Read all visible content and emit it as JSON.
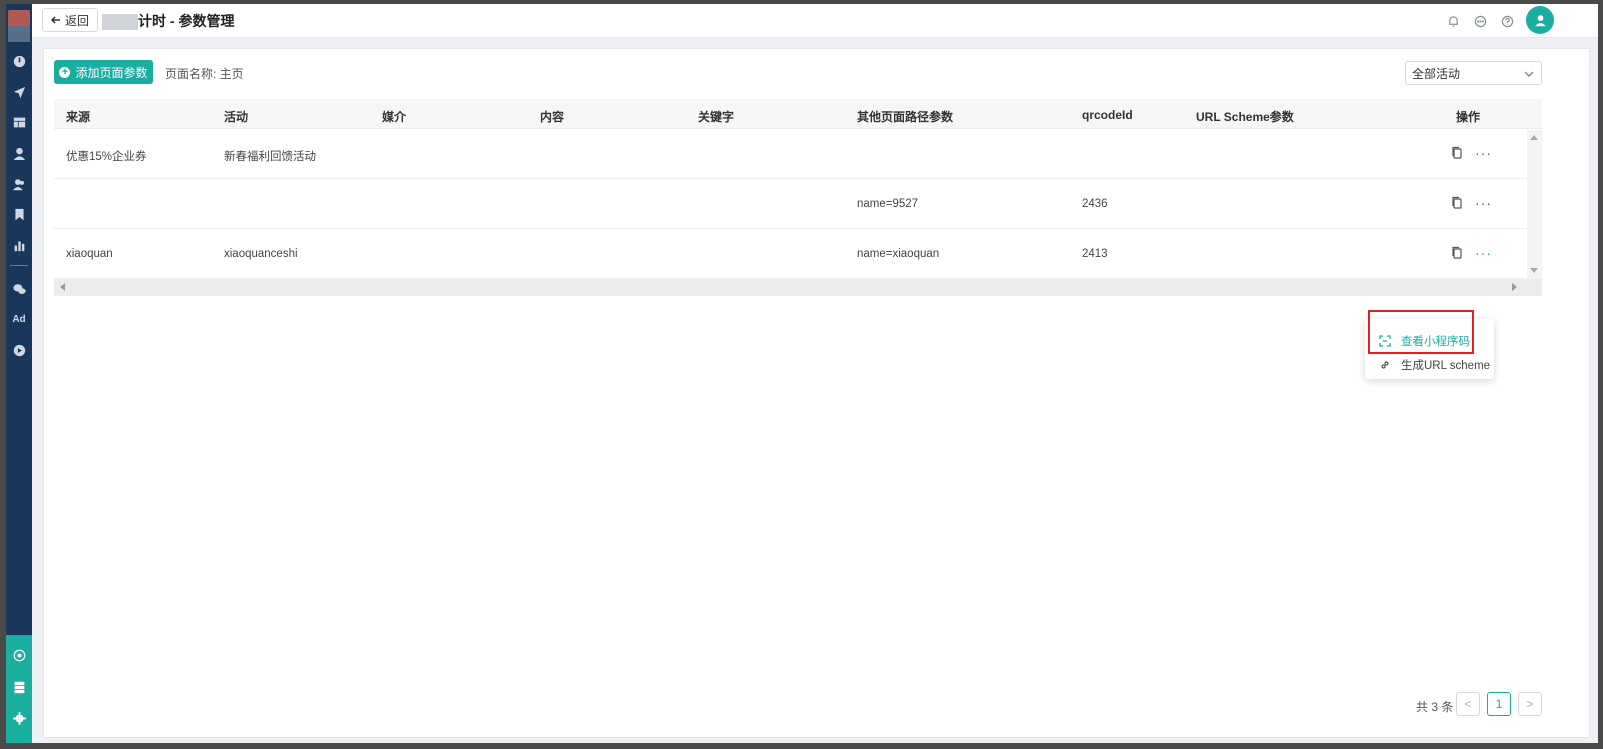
{
  "header": {
    "back_label": "返回",
    "title": "计时 - 参数管理"
  },
  "toolbar": {
    "add_label": "添加页面参数",
    "page_name": "页面名称: 主页",
    "activity_select": "全部活动"
  },
  "table": {
    "columns": [
      "来源",
      "活动",
      "媒介",
      "内容",
      "关键字",
      "其他页面路径参数",
      "qrcodeId",
      "URL Scheme参数",
      "操作"
    ],
    "rows": [
      {
        "source": "优惠15%企业券",
        "activity": "新春福利回馈活动",
        "medium": "",
        "content": "",
        "keyword": "",
        "other_params": "",
        "qrcode_id": "",
        "url_scheme": ""
      },
      {
        "source": "",
        "activity": "",
        "medium": "",
        "content": "",
        "keyword": "",
        "other_params": "name=9527",
        "qrcode_id": "2436",
        "url_scheme": ""
      },
      {
        "source": "xiaoquan",
        "activity": "xiaoquanceshi",
        "medium": "",
        "content": "",
        "keyword": "",
        "other_params": "name=xiaoquan",
        "qrcode_id": "2413",
        "url_scheme": ""
      }
    ]
  },
  "dropdown": {
    "items": [
      "查看小程序码",
      "生成URL scheme"
    ]
  },
  "pagination": {
    "total": "共 3 条",
    "current": "1",
    "prev": "<",
    "next": ">"
  },
  "sidebar": {
    "ad_label": "Ad"
  },
  "colors": {
    "accent": "#1aaea1",
    "sidebar": "#18375a",
    "highlight_border": "#e02020"
  }
}
